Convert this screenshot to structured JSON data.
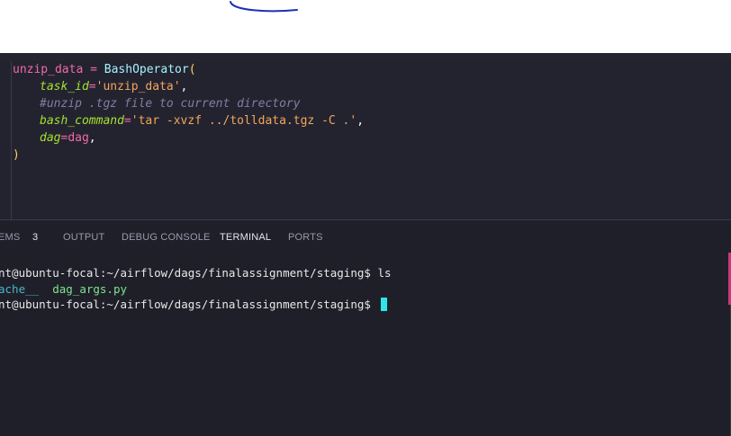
{
  "editor": {
    "lines": [
      {
        "var": "unzip_data",
        "op": " = ",
        "cls": "BashOperator",
        "paren": "("
      },
      {
        "param": "task_id",
        "eq": "=",
        "value": "'unzip_data'",
        "comma": ","
      },
      {
        "comment": "#unzip .tgz file to current directory"
      },
      {
        "param": "bash_command",
        "eq": "=",
        "value": "'tar -xvzf ../tolldata.tgz -C .'",
        "comma": ","
      },
      {
        "param": "dag",
        "eq": "=",
        "value": "dag",
        "comma": ","
      },
      {
        "paren": ")"
      }
    ]
  },
  "panel": {
    "tabs": [
      {
        "label": "EMS",
        "badge": "3"
      },
      {
        "label": "OUTPUT"
      },
      {
        "label": "DEBUG CONSOLE"
      },
      {
        "label": "TERMINAL",
        "active": true
      },
      {
        "label": "PORTS"
      }
    ],
    "terminal": {
      "prompt": "nt@ubuntu-focal:~/airflow/dags/finalassignment/staging$ ",
      "command": "ls",
      "listing": [
        "ache__",
        "dag_args.py"
      ]
    }
  },
  "colors": {
    "editor_bg": "#232330",
    "panel_bg": "#1f1f2a",
    "cursor": "#2ee6e6",
    "annotation_stroke": "#1f2fb8"
  }
}
